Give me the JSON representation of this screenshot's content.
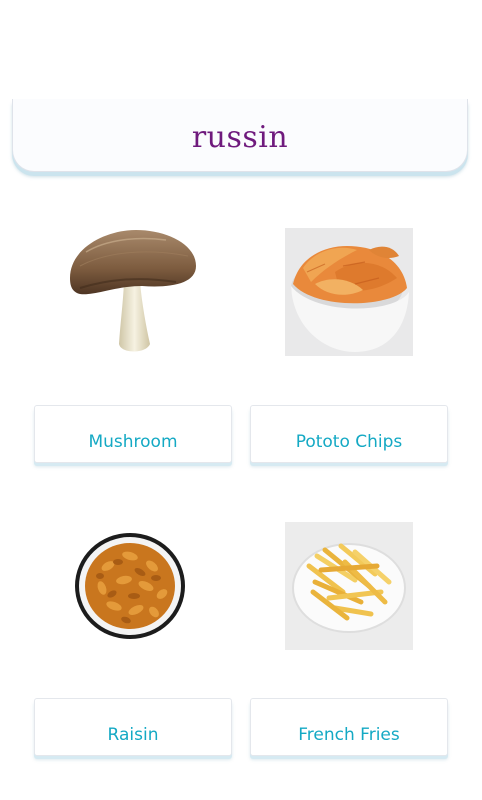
{
  "question": {
    "word": "russin"
  },
  "options": [
    {
      "label": "Mushroom",
      "image": "mushroom-image"
    },
    {
      "label": "Pototo Chips",
      "image": "potato-chips-image"
    },
    {
      "label": "Raisin",
      "image": "raisin-bowl-image"
    },
    {
      "label": "French Fries",
      "image": "french-fries-image"
    }
  ],
  "colors": {
    "word": "#6f1a7d",
    "option_text": "#14a9c4",
    "card_shadow": "#cbe4ee"
  }
}
